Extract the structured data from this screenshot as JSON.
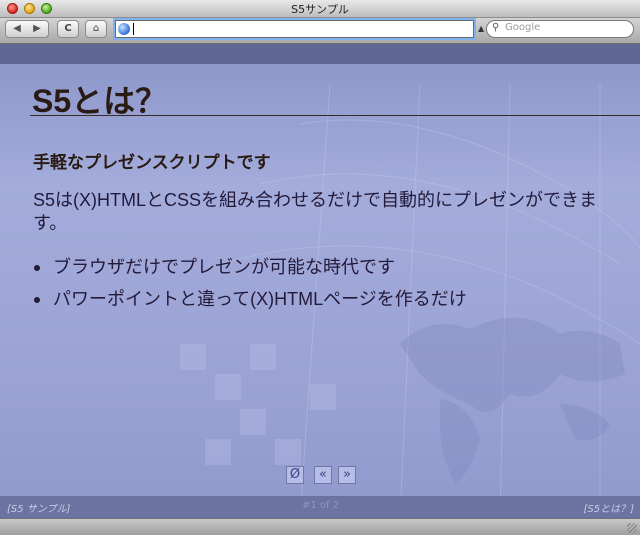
{
  "window": {
    "title": "S5サンプル"
  },
  "toolbar": {
    "back_icon": "◀",
    "forward_icon": "▶",
    "reload_icon": "C",
    "home_icon": "⌂",
    "address_value": "",
    "search_placeholder": "Google"
  },
  "slide": {
    "title": "S5とは？",
    "subheading": "手軽なプレゼンスクリプトです",
    "paragraph": "S5は(X)HTMLとCSSを組み合わせるだけで自動的にプレゼンができます。",
    "bullets": [
      "ブラウザだけでプレゼンが可能な時代です",
      "パワーポイントと違って(X)HTMLページを作るだけ"
    ]
  },
  "controls": {
    "toggle": "Ø",
    "prev": "«",
    "next": "»"
  },
  "footer": {
    "left": "[S5 サンプル]",
    "counter": "#1 of 2",
    "right": "[S5とは？]"
  }
}
